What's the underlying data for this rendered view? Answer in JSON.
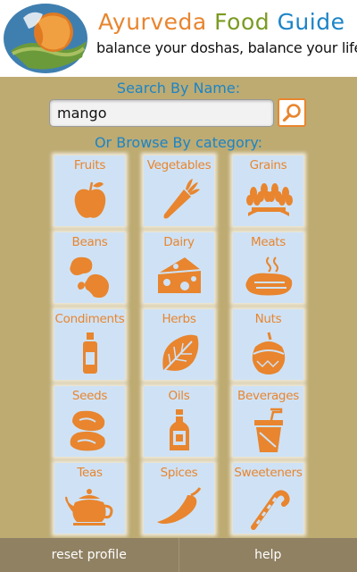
{
  "header": {
    "title_word1": "Ayurveda",
    "title_word2": "Food",
    "title_word3": "Guide",
    "tagline": "balance your doshas, balance your life!"
  },
  "search": {
    "label": "Search By Name:",
    "value": "mango",
    "button_icon": "magnifier-icon"
  },
  "browse": {
    "label": "Or Browse By category:",
    "categories": [
      {
        "label": "Fruits",
        "icon": "apple-icon"
      },
      {
        "label": "Vegetables",
        "icon": "carrot-icon"
      },
      {
        "label": "Grains",
        "icon": "wheat-icon"
      },
      {
        "label": "Beans",
        "icon": "beans-icon"
      },
      {
        "label": "Dairy",
        "icon": "cheese-icon"
      },
      {
        "label": "Meats",
        "icon": "steak-icon"
      },
      {
        "label": "Condiments",
        "icon": "bottle-icon"
      },
      {
        "label": "Herbs",
        "icon": "leaf-icon"
      },
      {
        "label": "Nuts",
        "icon": "hazelnut-icon"
      },
      {
        "label": "Seeds",
        "icon": "seeds-icon"
      },
      {
        "label": "Oils",
        "icon": "oil-bottle-icon"
      },
      {
        "label": "Beverages",
        "icon": "cup-icon"
      },
      {
        "label": "Teas",
        "icon": "teapot-icon"
      },
      {
        "label": "Spices",
        "icon": "chili-icon"
      },
      {
        "label": "Sweeteners",
        "icon": "candy-cane-icon"
      }
    ]
  },
  "footer": {
    "reset_label": "reset profile",
    "help_label": "help"
  },
  "colors": {
    "background": "#beab72",
    "accent_orange": "#e8852e",
    "accent_blue": "#1c84c6",
    "accent_green": "#7a9b22",
    "tile_bg": "#cfe2f5",
    "footer_bg": "#8f8162"
  }
}
